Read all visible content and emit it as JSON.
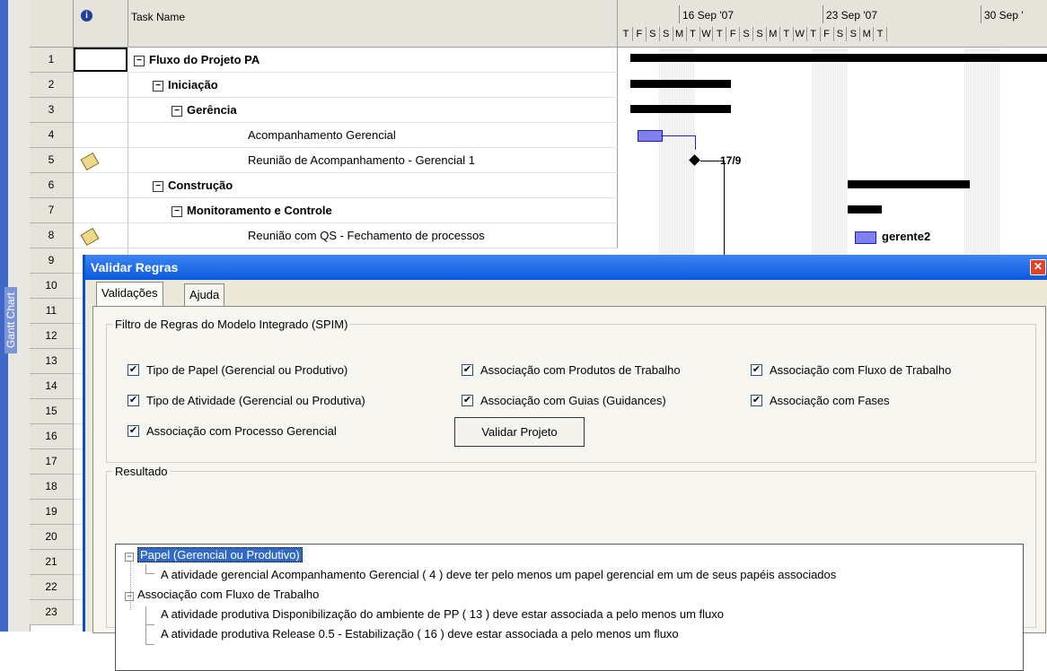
{
  "sidebar": {
    "label": "Gantt Chart"
  },
  "table": {
    "task_name_header": "Task Name",
    "info_icon": "info-icon",
    "rows": [
      {
        "n": "1",
        "name": "Fluxo do Projeto PA",
        "level": 0,
        "bold": true,
        "collapse": "−",
        "note": false
      },
      {
        "n": "2",
        "name": "Iniciação",
        "level": 1,
        "bold": true,
        "collapse": "−",
        "note": false
      },
      {
        "n": "3",
        "name": "Gerência",
        "level": 2,
        "bold": true,
        "collapse": "−",
        "note": false
      },
      {
        "n": "4",
        "name": "Acompanhamento Gerencial",
        "level": 3,
        "bold": false,
        "collapse": "",
        "note": false
      },
      {
        "n": "5",
        "name": "Reunião de Acompanhamento - Gerencial 1",
        "level": 3,
        "bold": false,
        "collapse": "",
        "note": true
      },
      {
        "n": "6",
        "name": "Construção",
        "level": 1,
        "bold": true,
        "collapse": "−",
        "note": false
      },
      {
        "n": "7",
        "name": "Monitoramento e Controle",
        "level": 2,
        "bold": true,
        "collapse": "−",
        "note": false
      },
      {
        "n": "8",
        "name": "Reunião com QS - Fechamento de processos",
        "level": 3,
        "bold": false,
        "collapse": "",
        "note": true
      }
    ],
    "more_rows": [
      "9",
      "10",
      "11",
      "12",
      "13",
      "14",
      "15",
      "16",
      "17",
      "18",
      "19",
      "20",
      "21",
      "22",
      "23"
    ]
  },
  "timescale": {
    "weeks": [
      "16 Sep '07",
      "23 Sep '07",
      "30 Sep '"
    ],
    "days": [
      "T",
      "F",
      "S",
      "S",
      "M",
      "T",
      "W",
      "T",
      "F",
      "S",
      "S",
      "M",
      "T",
      "W",
      "T",
      "F",
      "S",
      "S",
      "M",
      "T"
    ]
  },
  "gantt_labels": {
    "milestone": "17/9",
    "resource": "gerente2"
  },
  "dialog": {
    "title": "Validar Regras",
    "close": "✕",
    "tabs": [
      "Validações",
      "Ajuda"
    ],
    "filter_group": "Filtro de Regras do Modelo Integrado (SPIM)",
    "checkboxes": [
      {
        "label": "Tipo de Papel (Gerencial ou Produtivo)",
        "checked": true
      },
      {
        "label": "Associação com Produtos de Trabalho",
        "checked": true
      },
      {
        "label": "Associação com Fluxo de Trabalho",
        "checked": true
      },
      {
        "label": "Tipo de Atividade (Gerencial ou Produtiva)",
        "checked": true
      },
      {
        "label": "Associação com Guias (Guidances)",
        "checked": true
      },
      {
        "label": "Associação com Fases",
        "checked": true
      },
      {
        "label": "Associação com Processo Gerencial",
        "checked": true
      }
    ],
    "validate_button": "Validar Projeto",
    "result_group": "Resultado",
    "results": [
      {
        "text": "Papel (Gerencial ou Produtivo)",
        "kind": "group",
        "selected": true
      },
      {
        "text": "A atividade gerencial Acompanhamento Gerencial ( 4 ) deve ter pelo menos um papel gerencial em um de seus papéis associados",
        "kind": "item"
      },
      {
        "text": "Associação com Fluxo de Trabalho",
        "kind": "group",
        "selected": false
      },
      {
        "text": "A atividade produtiva Disponibilização do ambiente de PP ( 13 ) deve estar associada a pelo menos um fluxo",
        "kind": "item"
      },
      {
        "text": "A atividade produtiva Release 0.5 - Estabilização ( 16 ) deve estar associada a pelo menos um fluxo",
        "kind": "item"
      }
    ]
  }
}
